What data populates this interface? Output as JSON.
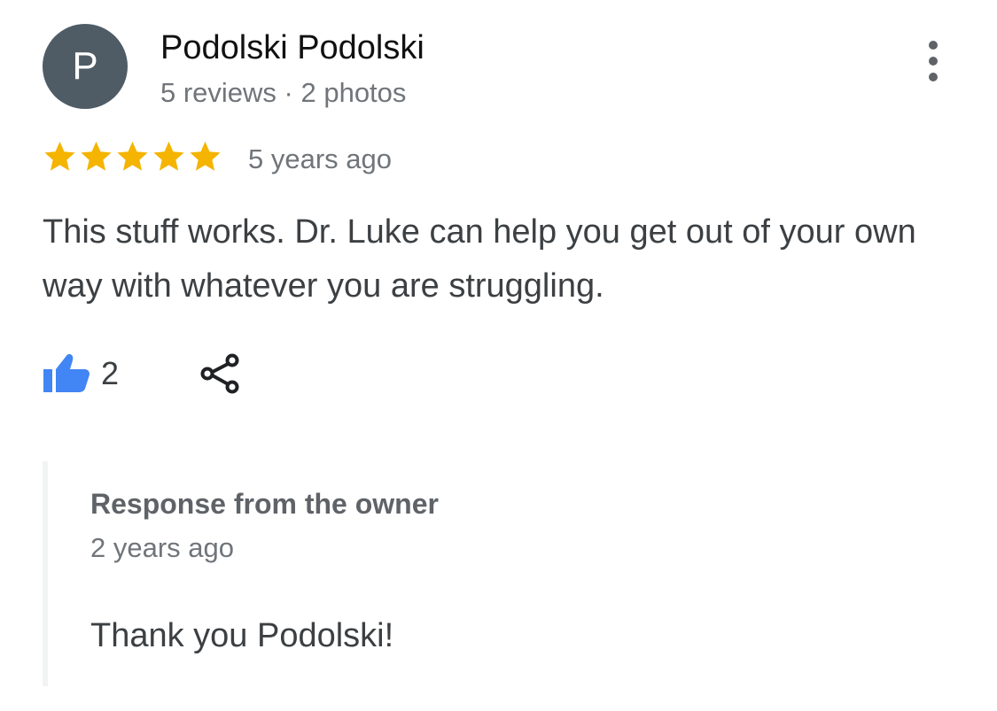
{
  "reviewer": {
    "avatar_letter": "P",
    "avatar_color": "#4f5c66",
    "name": "Podolski Podolski",
    "meta": "5 reviews · 2 photos"
  },
  "menu": {
    "icon": "more-vert-icon"
  },
  "review": {
    "rating": 5,
    "rating_max": 5,
    "star_color": "#f4b400",
    "time": "5 years ago",
    "text": "This stuff works. Dr. Luke can help you get out of your own way with whatever you are struggling."
  },
  "actions": {
    "like_icon": "thumbs-up-icon",
    "like_color": "#4285f4",
    "like_count": "2",
    "share_icon": "share-icon"
  },
  "owner_response": {
    "title": "Response from the owner",
    "time": "2 years ago",
    "text": "Thank you Podolski!"
  }
}
